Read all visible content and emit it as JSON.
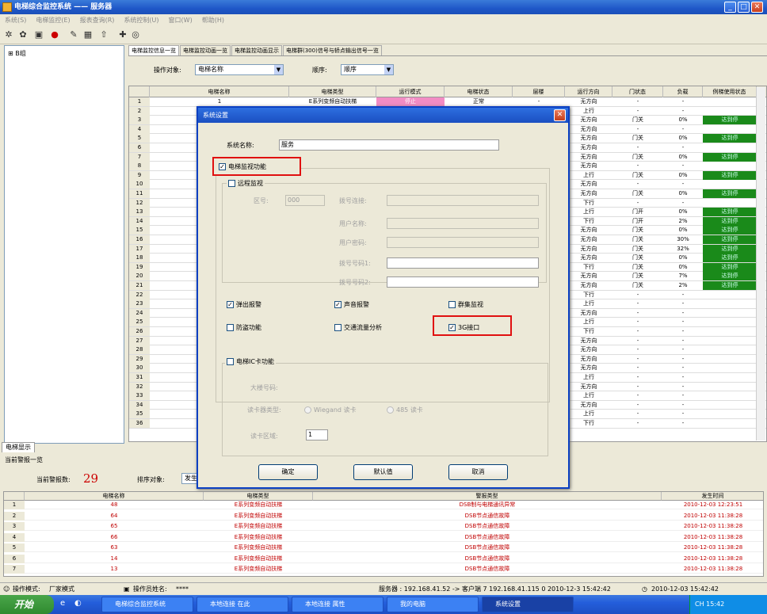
{
  "window": {
    "title": "电梯综合监控系统 —— 服务器"
  },
  "menu": [
    "系统(S)",
    "电梯监控(E)",
    "报表查询(R)",
    "系统控制(U)",
    "窗口(W)",
    "帮助(H)"
  ],
  "toolbar_icons": [
    "✲",
    "✿",
    "▣",
    "●",
    "✎",
    "▦",
    "⇧",
    "✚",
    "◎"
  ],
  "tree": {
    "root": "B组",
    "expander": "⊞"
  },
  "left_tab": "电梯显示",
  "tabs": [
    "电梯监控信息一览",
    "电梯监控动画一览",
    "电梯监控动画显示",
    "电梯群(300)信号与轿点输出信号一览"
  ],
  "filter": {
    "object_label": "操作对象:",
    "object_value": "电梯名称",
    "order_label": "顺序:",
    "order_value": "顺序"
  },
  "grid": {
    "headers": [
      "",
      "电梯名称",
      "电梯类型",
      "运行模式",
      "电梯状态",
      "层楼",
      "运行方向",
      "门状态",
      "负载",
      "例梯使用状态"
    ],
    "first_row": {
      "num": "1",
      "name": "1",
      "type": "E系列变频自动扶梯",
      "mode": "停止",
      "status": "正常",
      "floor": "-"
    },
    "rows": [
      {
        "num": "1",
        "dir": "无方向",
        "door": "-",
        "load": "-",
        "use": ""
      },
      {
        "num": "2",
        "dir": "上行",
        "door": "-",
        "load": "-",
        "use": ""
      },
      {
        "num": "3",
        "dir": "无方向",
        "door": "门关",
        "load": "0%",
        "use": "达到停"
      },
      {
        "num": "4",
        "dir": "无方向",
        "door": "-",
        "load": "-",
        "use": ""
      },
      {
        "num": "5",
        "dir": "无方向",
        "door": "门关",
        "load": "0%",
        "use": "达到停"
      },
      {
        "num": "6",
        "dir": "无方向",
        "door": "-",
        "load": "-",
        "use": ""
      },
      {
        "num": "7",
        "dir": "无方向",
        "door": "门关",
        "load": "0%",
        "use": "达到停"
      },
      {
        "num": "8",
        "dir": "无方向",
        "door": "-",
        "load": "-",
        "use": ""
      },
      {
        "num": "9",
        "dir": "上行",
        "door": "门关",
        "load": "0%",
        "use": "达到停"
      },
      {
        "num": "10",
        "dir": "无方向",
        "door": "-",
        "load": "-",
        "use": ""
      },
      {
        "num": "11",
        "dir": "无方向",
        "door": "门关",
        "load": "0%",
        "use": "达到停"
      },
      {
        "num": "12",
        "dir": "下行",
        "door": "-",
        "load": "-",
        "use": ""
      },
      {
        "num": "13",
        "dir": "上行",
        "door": "门开",
        "load": "0%",
        "use": "达到停"
      },
      {
        "num": "14",
        "dir": "下行",
        "door": "门开",
        "load": "2%",
        "use": "达到停"
      },
      {
        "num": "15",
        "dir": "无方向",
        "door": "门关",
        "load": "0%",
        "use": "达到停"
      },
      {
        "num": "16",
        "dir": "无方向",
        "door": "门关",
        "load": "30%",
        "use": "达到停"
      },
      {
        "num": "17",
        "dir": "无方向",
        "door": "门关",
        "load": "32%",
        "use": "达到停"
      },
      {
        "num": "18",
        "dir": "无方向",
        "door": "门关",
        "load": "0%",
        "use": "达到停"
      },
      {
        "num": "19",
        "dir": "下行",
        "door": "门关",
        "load": "0%",
        "use": "达到停"
      },
      {
        "num": "20",
        "dir": "无方向",
        "door": "门关",
        "load": "7%",
        "use": "达到停"
      },
      {
        "num": "21",
        "dir": "无方向",
        "door": "门关",
        "load": "2%",
        "use": "达到停"
      },
      {
        "num": "22",
        "dir": "下行",
        "door": "-",
        "load": "-",
        "use": ""
      },
      {
        "num": "23",
        "dir": "上行",
        "door": "-",
        "load": "-",
        "use": ""
      },
      {
        "num": "24",
        "dir": "无方向",
        "door": "-",
        "load": "-",
        "use": ""
      },
      {
        "num": "25",
        "dir": "上行",
        "door": "-",
        "load": "-",
        "use": ""
      },
      {
        "num": "26",
        "dir": "下行",
        "door": "-",
        "load": "-",
        "use": ""
      },
      {
        "num": "27",
        "dir": "无方向",
        "door": "-",
        "load": "-",
        "use": ""
      },
      {
        "num": "28",
        "dir": "无方向",
        "door": "-",
        "load": "-",
        "use": ""
      },
      {
        "num": "29",
        "dir": "无方向",
        "door": "-",
        "load": "-",
        "use": ""
      },
      {
        "num": "30",
        "dir": "无方向",
        "door": "-",
        "load": "-",
        "use": ""
      },
      {
        "num": "31",
        "dir": "上行",
        "door": "-",
        "load": "-",
        "use": ""
      },
      {
        "num": "32",
        "dir": "无方向",
        "door": "-",
        "load": "-",
        "use": ""
      },
      {
        "num": "33",
        "dir": "上行",
        "door": "-",
        "load": "-",
        "use": ""
      },
      {
        "num": "34",
        "dir": "无方向",
        "door": "-",
        "load": "-",
        "use": ""
      },
      {
        "num": "35",
        "dir": "上行",
        "door": "-",
        "load": "-",
        "use": ""
      },
      {
        "num": "36",
        "dir": "下行",
        "door": "-",
        "load": "-",
        "use": ""
      }
    ]
  },
  "alarm": {
    "title": "当前警报一览",
    "count_label": "当前警报数:",
    "count": "29",
    "sort_label": "排序对象:",
    "sort_value": "发生",
    "headers": [
      "",
      "电梯名称",
      "电梯类型",
      "警报类型",
      "发生时间"
    ],
    "rows": [
      {
        "num": "1",
        "name": "48",
        "type": "E系列变频自动扶梯",
        "alarm": "DSB制与电梯通讯异常",
        "time": "2010-12-03 12:23:51"
      },
      {
        "num": "2",
        "name": "64",
        "type": "E系列变频自动扶梯",
        "alarm": "DSB节点通信故障",
        "time": "2010-12-03 11:38:28"
      },
      {
        "num": "3",
        "name": "65",
        "type": "E系列变频自动扶梯",
        "alarm": "DSB节点通信故障",
        "time": "2010-12-03 11:38:28"
      },
      {
        "num": "4",
        "name": "66",
        "type": "E系列变频自动扶梯",
        "alarm": "DSB节点通信故障",
        "time": "2010-12-03 11:38:28"
      },
      {
        "num": "5",
        "name": "63",
        "type": "E系列变频自动扶梯",
        "alarm": "DSB节点通信故障",
        "time": "2010-12-03 11:38:28"
      },
      {
        "num": "6",
        "name": "14",
        "type": "E系列变频自动扶梯",
        "alarm": "DSB节点通信故障",
        "time": "2010-12-03 11:38:28"
      },
      {
        "num": "7",
        "name": "13",
        "type": "E系列变频自动扶梯",
        "alarm": "DSB节点通信故障",
        "time": "2010-12-03 11:38:28"
      }
    ]
  },
  "dialog": {
    "title": "系统设置",
    "close": "✕",
    "system_name_label": "系统名称:",
    "system_name_value": "服务",
    "monitor_label": "电梯监视功能",
    "remote_label": "远程监视",
    "area_label": "区号:",
    "area_value": "000",
    "dial_label": "拨号连接:",
    "user_label": "用户名称:",
    "password_label": "用户密码:",
    "phone1_label": "拨号号码1:",
    "phone2_label": "拨号号码2:",
    "popup_alarm_label": "弹出报警",
    "sound_alarm_label": "声音报警",
    "energy_label": "群集监视",
    "theft_label": "防盗功能",
    "traffic_label": "交通流量分析",
    "port_label": "3G接口",
    "card_label": "电梯IC卡功能",
    "building_label": "大楼号码:",
    "reader_label": "读卡器类型:",
    "reader_opt1": "Wiegand 读卡",
    "reader_opt2": "485 读卡",
    "readarea_label": "读卡区域:",
    "readarea_value": "1",
    "ok_button": "确定",
    "default_button": "默认值",
    "cancel_button": "取消"
  },
  "status": {
    "mode_label": "操作模式:",
    "mode_value": "厂家模式",
    "operator_label": "操作员姓名:",
    "operator_value": "****",
    "server_text": "服务器 : 192.168.41.52 -> 客户端 7 192.168.41.115 0 2010-12-3 15:42:42",
    "clock_text": "2010-12-03 15:42:42"
  },
  "taskbar": {
    "start": "开始",
    "items": [
      "电梯综合监控系统",
      "本地连接 在此",
      "本地连接 属性",
      "我的电脑",
      "系统设置"
    ],
    "tray": "CH  15:42"
  },
  "colors": {
    "alarm_red": "#c00000",
    "use_green": "#1a8a1a",
    "mode_pink": "#f28cc4",
    "highlight_red": "#e01010"
  }
}
